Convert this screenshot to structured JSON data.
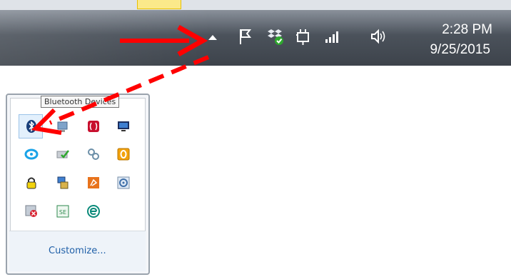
{
  "taskbar": {
    "clock_time": "2:28 PM",
    "clock_date": "9/25/2015",
    "tray_icons": [
      "show-hidden-icons-chevron",
      "action-center-flag-icon",
      "dropbox-sync-icon",
      "power-plug-icon",
      "network-signal-icon",
      "volume-icon"
    ]
  },
  "overflow_popup": {
    "tooltip": "Bluetooth Devices",
    "customize_label": "Customize...",
    "icons": [
      "bluetooth-icon",
      "network-monitor-icon",
      "red-app-icon",
      "display-icon",
      "blue-ring-icon",
      "checkmark-device-icon",
      "link-chain-icon",
      "orange-o-icon",
      "yellow-lock-icon",
      "server-computer-icon",
      "orange-scroll-icon",
      "disc-circle-icon",
      "red-x-shield-icon",
      "se-box-icon",
      "eset-e-icon"
    ]
  },
  "annotation": {
    "arrow_color": "#ff0000"
  }
}
